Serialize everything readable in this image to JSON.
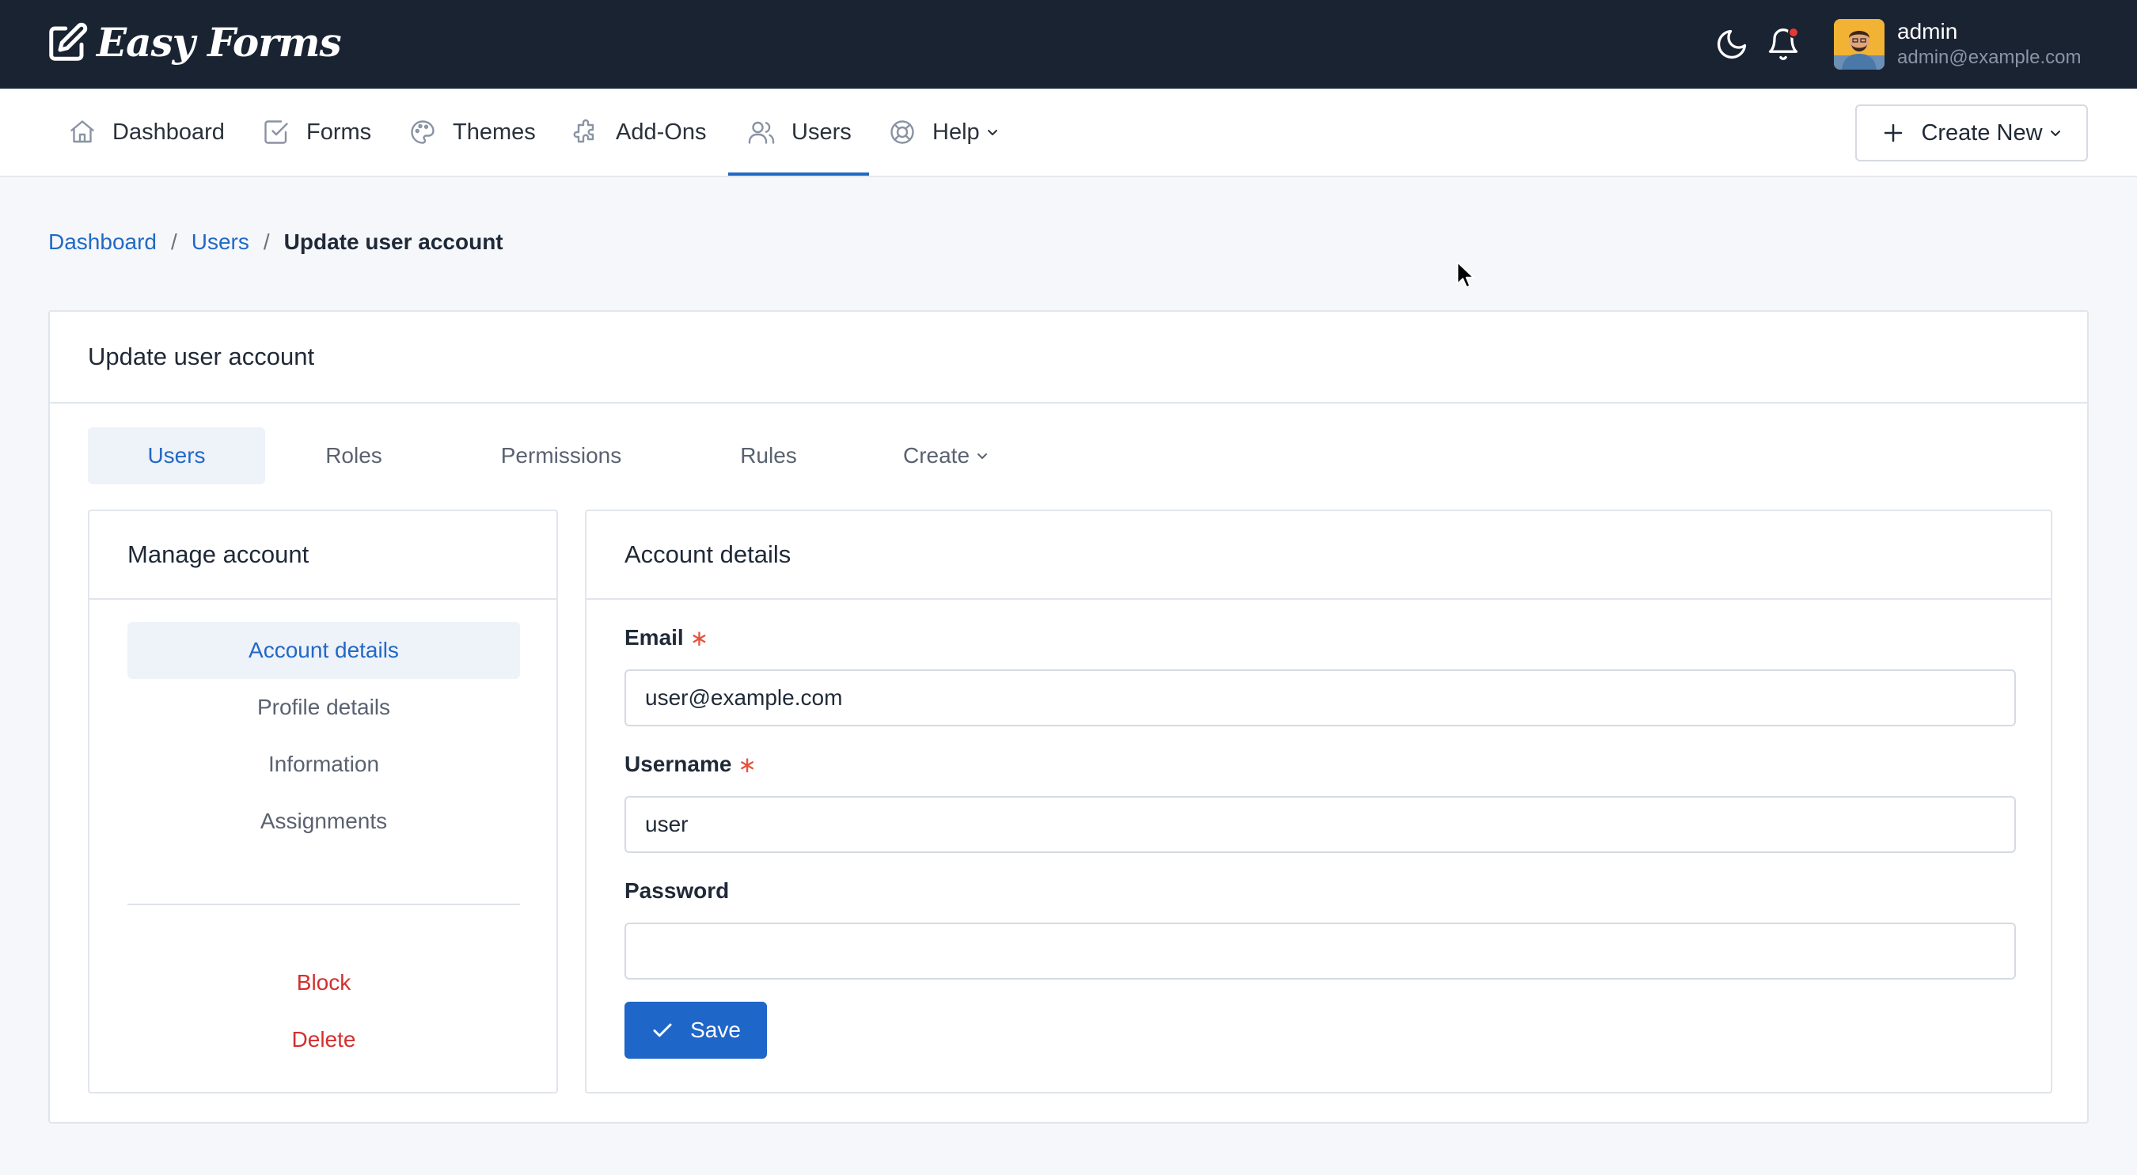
{
  "brand": {
    "name": "Easy Forms"
  },
  "user": {
    "name": "admin",
    "email": "admin@example.com"
  },
  "nav": {
    "items": [
      {
        "label": "Dashboard",
        "icon": "home-icon"
      },
      {
        "label": "Forms",
        "icon": "checkbox-icon"
      },
      {
        "label": "Themes",
        "icon": "palette-icon"
      },
      {
        "label": "Add-Ons",
        "icon": "puzzle-icon"
      },
      {
        "label": "Users",
        "icon": "users-icon",
        "active": true
      },
      {
        "label": "Help",
        "icon": "lifebuoy-icon",
        "dropdown": true
      }
    ],
    "create_label": "Create New"
  },
  "breadcrumb": {
    "items": [
      "Dashboard",
      "Users"
    ],
    "current": "Update user account"
  },
  "card": {
    "title": "Update user account"
  },
  "tabs": [
    {
      "label": "Users",
      "active": true
    },
    {
      "label": "Roles"
    },
    {
      "label": "Permissions"
    },
    {
      "label": "Rules"
    },
    {
      "label": "Create",
      "dropdown": true
    }
  ],
  "manage": {
    "title": "Manage account",
    "items": [
      "Account details",
      "Profile details",
      "Information",
      "Assignments"
    ],
    "active": "Account details",
    "danger": [
      "Block",
      "Delete"
    ]
  },
  "account": {
    "title": "Account details",
    "email_label": "Email",
    "email_value": "user@example.com",
    "username_label": "Username",
    "username_value": "user",
    "password_label": "Password",
    "password_value": "",
    "required_mark": "∗",
    "save_label": "Save"
  },
  "colors": {
    "accent": "#2169c5",
    "topbar": "#1a2332",
    "danger": "#d32f2f"
  }
}
